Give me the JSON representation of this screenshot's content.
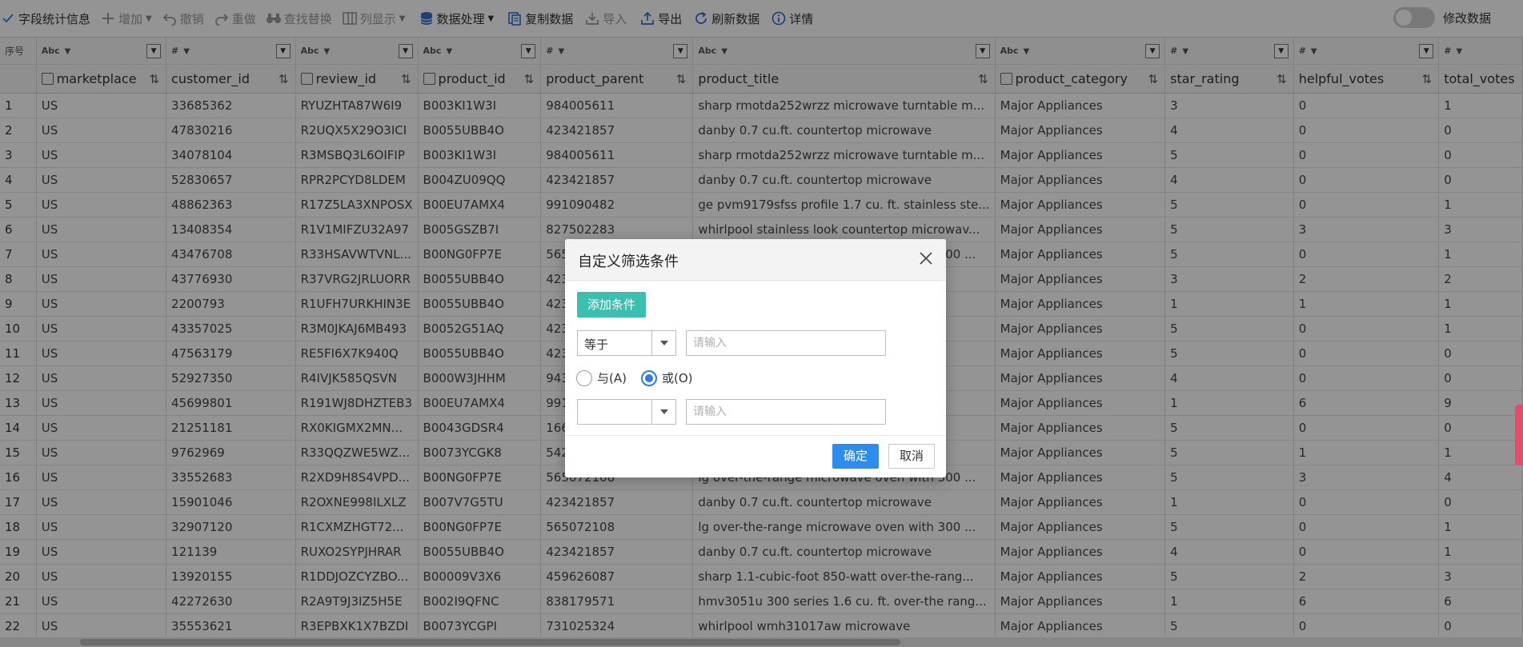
{
  "toolbar": {
    "items": [
      {
        "label": "字段统计信息",
        "icon": "check-icon",
        "disabled": false
      },
      {
        "label": "增加",
        "icon": "plus-icon",
        "disabled": true,
        "dropdown": true
      },
      {
        "label": "撤销",
        "icon": "undo-icon",
        "disabled": true
      },
      {
        "label": "重做",
        "icon": "redo-icon",
        "disabled": true
      },
      {
        "label": "查找替换",
        "icon": "binoculars-icon",
        "disabled": true
      },
      {
        "label": "列显示",
        "icon": "columns-icon",
        "disabled": true,
        "dropdown": true
      },
      {
        "label": "数据处理",
        "icon": "database-icon",
        "disabled": false,
        "dropdown": true
      },
      {
        "label": "复制数据",
        "icon": "copy-icon",
        "disabled": false
      },
      {
        "label": "导入",
        "icon": "import-icon",
        "disabled": true
      },
      {
        "label": "导出",
        "icon": "export-icon",
        "disabled": false
      },
      {
        "label": "刷新数据",
        "icon": "refresh-icon",
        "disabled": false
      },
      {
        "label": "详情",
        "icon": "info-icon",
        "disabled": false
      }
    ],
    "toggle_label": "修改数据",
    "toggle_on": false
  },
  "grid": {
    "index_header": "序号",
    "columns": [
      {
        "name": "marketplace",
        "type": "Abc",
        "field_icon": true
      },
      {
        "name": "customer_id",
        "type": "#",
        "field_icon": false
      },
      {
        "name": "review_id",
        "type": "Abc",
        "field_icon": true
      },
      {
        "name": "product_id",
        "type": "Abc",
        "field_icon": true
      },
      {
        "name": "product_parent",
        "type": "#",
        "field_icon": false
      },
      {
        "name": "product_title",
        "type": "Abc",
        "field_icon": false
      },
      {
        "name": "product_category",
        "type": "Abc",
        "field_icon": true
      },
      {
        "name": "star_rating",
        "type": "#",
        "field_icon": false
      },
      {
        "name": "helpful_votes",
        "type": "#",
        "field_icon": false
      },
      {
        "name": "total_votes",
        "type": "#",
        "field_icon": false
      }
    ],
    "rows": [
      [
        "1",
        "US",
        "33685362",
        "RYUZHTA87W6I9",
        "B003KI1W3I",
        "984005611",
        "sharp rmotda252wrzz microwave turntable m...",
        "Major Appliances",
        "3",
        "0",
        "1"
      ],
      [
        "2",
        "US",
        "47830216",
        "R2UQX5X29O3ICI",
        "B0055UBB4O",
        "423421857",
        "danby 0.7 cu.ft. countertop microwave",
        "Major Appliances",
        "4",
        "0",
        "0"
      ],
      [
        "3",
        "US",
        "34078104",
        "R3MSBQ3L6OIFIP",
        "B003KI1W3I",
        "984005611",
        "sharp rmotda252wrzz microwave turntable m...",
        "Major Appliances",
        "5",
        "0",
        "0"
      ],
      [
        "4",
        "US",
        "52830657",
        "RPR2PCYD8LDEM",
        "B004ZU09QQ",
        "423421857",
        "danby 0.7 cu.ft. countertop microwave",
        "Major Appliances",
        "4",
        "0",
        "0"
      ],
      [
        "5",
        "US",
        "48862363",
        "R17Z5LA3XNPOSX",
        "B00EU7AMX4",
        "991090482",
        "ge pvm9179sfss profile 1.7 cu. ft. stainless ste...",
        "Major Appliances",
        "5",
        "0",
        "1"
      ],
      [
        "6",
        "US",
        "13408354",
        "R1V1MIFZU32A97",
        "B005GSZB7I",
        "827502283",
        "whirlpool stainless look countertop microwav...",
        "Major Appliances",
        "5",
        "3",
        "3"
      ],
      [
        "7",
        "US",
        "43476708",
        "R33HSAVWTVNL...",
        "B00NG0FP7E",
        "565",
        "lg over-the-range microwave oven with 300 ...",
        "Major Appliances",
        "5",
        "0",
        "1"
      ],
      [
        "8",
        "US",
        "43776930",
        "R37VRG2JRLUORR",
        "B0055UBB4O",
        "423",
        "",
        "Major Appliances",
        "3",
        "2",
        "2"
      ],
      [
        "9",
        "US",
        "2200793",
        "R1UFH7URKHIN3E",
        "B0055UBB4O",
        "423",
        "",
        "Major Appliances",
        "1",
        "1",
        "1"
      ],
      [
        "10",
        "US",
        "43357025",
        "R3M0JKAJ6MB493",
        "B0052G51AQ",
        "423",
        "",
        "Major Appliances",
        "5",
        "0",
        "1"
      ],
      [
        "11",
        "US",
        "47563179",
        "RE5FI6X7K940Q",
        "B0055UBB4O",
        "423",
        "",
        "Major Appliances",
        "5",
        "0",
        "0"
      ],
      [
        "12",
        "US",
        "52927350",
        "R4IVJK585QSVN",
        "B000W3JHHM",
        "943",
        "rto...",
        "Major Appliances",
        "4",
        "0",
        "0"
      ],
      [
        "13",
        "US",
        "45699801",
        "R191WJ8DHZTEB3",
        "B00EU7AMX4",
        "991",
        "ste...",
        "Major Appliances",
        "1",
        "6",
        "9"
      ],
      [
        "14",
        "US",
        "21251181",
        "RX0KIGMX2MN...",
        "B0043GDSR4",
        "166",
        "ainl...",
        "Major Appliances",
        "5",
        "0",
        "0"
      ],
      [
        "15",
        "US",
        "9762969",
        "R33QQZWE5WZ...",
        "B0073YCGK8",
        "542",
        "-ra...",
        "Major Appliances",
        "5",
        "1",
        "1"
      ],
      [
        "16",
        "US",
        "33552683",
        "R2XD9H8S4VPD...",
        "B00NG0FP7E",
        "565072108",
        "lg over-the-range microwave oven with 300 ...",
        "Major Appliances",
        "5",
        "3",
        "4"
      ],
      [
        "17",
        "US",
        "15901046",
        "R2OXNE998ILXLZ",
        "B007V7G5TU",
        "423421857",
        "danby 0.7 cu.ft. countertop microwave",
        "Major Appliances",
        "1",
        "0",
        "0"
      ],
      [
        "18",
        "US",
        "32907120",
        "R1CXMZHGT72...",
        "B00NG0FP7E",
        "565072108",
        "lg over-the-range microwave oven with 300 ...",
        "Major Appliances",
        "5",
        "0",
        "1"
      ],
      [
        "19",
        "US",
        "121139",
        "RUXO2SYPJHRAR",
        "B0055UBB4O",
        "423421857",
        "danby 0.7 cu.ft. countertop microwave",
        "Major Appliances",
        "4",
        "0",
        "1"
      ],
      [
        "20",
        "US",
        "13920155",
        "R1DDJOZCYZBO...",
        "B00009V3X6",
        "459626087",
        "sharp 1.1-cubic-foot 850-watt over-the-rang...",
        "Major Appliances",
        "5",
        "2",
        "3"
      ],
      [
        "21",
        "US",
        "42272630",
        "R2A9T9J3IZ5H5E",
        "B002I9QFNC",
        "838179571",
        "hmv3051u 300 series 1.6 cu. ft. over-the rang...",
        "Major Appliances",
        "1",
        "6",
        "6"
      ],
      [
        "22",
        "US",
        "35553621",
        "R3EPBXK1X7BZDI",
        "B0073YCGPI",
        "731025324",
        "whirlpool wmh31017aw microwave",
        "Major Appliances",
        "5",
        "0",
        "0"
      ]
    ]
  },
  "dialog": {
    "title": "自定义筛选条件",
    "add_condition_label": "添加条件",
    "condition1": {
      "operator": "等于",
      "placeholder": "请输入"
    },
    "logic": {
      "and_label": "与(A)",
      "or_label": "或(O)",
      "selected": "or"
    },
    "condition2": {
      "operator": "",
      "placeholder": "请输入"
    },
    "ok_label": "确定",
    "cancel_label": "取消"
  },
  "colors": {
    "accent_teal": "#3bbfb0",
    "primary_blue": "#2d8cf0",
    "radio_blue": "#2d7be5"
  }
}
